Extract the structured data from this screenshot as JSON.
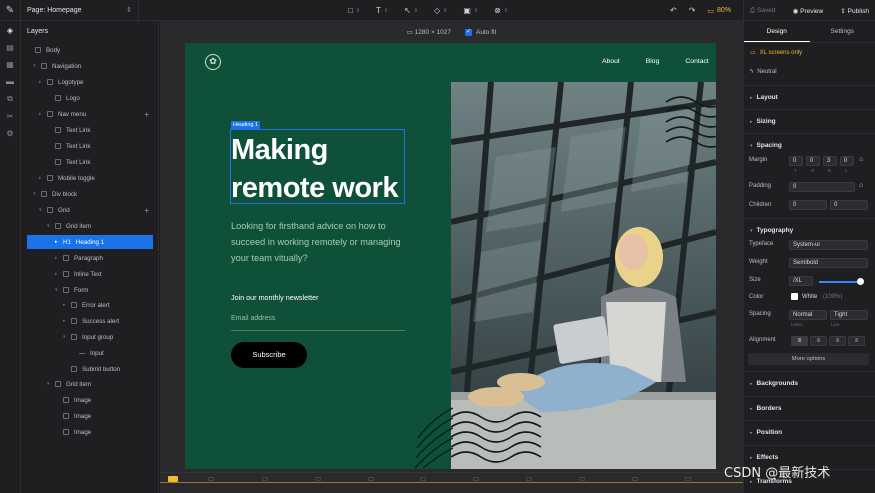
{
  "topbar": {
    "page_label": "Page: Homepage",
    "zoom": "80%",
    "saved": "Saved",
    "preview": "Preview",
    "publish": "Publish"
  },
  "layers": {
    "title": "Layers",
    "items": [
      {
        "label": "Body"
      },
      {
        "label": "Navigation"
      },
      {
        "label": "Logotype"
      },
      {
        "label": "Logo"
      },
      {
        "label": "Nav menu"
      },
      {
        "label": "Text Link"
      },
      {
        "label": "Text Link"
      },
      {
        "label": "Text Link"
      },
      {
        "label": "Mobile toggle"
      },
      {
        "label": "Div block"
      },
      {
        "label": "Grid"
      },
      {
        "label": "Grid item"
      },
      {
        "label": "Heading 1"
      },
      {
        "label": "Paragraph"
      },
      {
        "label": "Inline Text"
      },
      {
        "label": "Form"
      },
      {
        "label": "Error alert"
      },
      {
        "label": "Success alert"
      },
      {
        "label": "Input group"
      },
      {
        "label": "Input"
      },
      {
        "label": "Submit button"
      },
      {
        "label": "Grid item"
      },
      {
        "label": "Image"
      },
      {
        "label": "Image"
      },
      {
        "label": "Image"
      }
    ]
  },
  "canvas": {
    "size": "1280 × 1027",
    "autofit": "Auto fit"
  },
  "site": {
    "nav": [
      "About",
      "Blog",
      "Contact"
    ],
    "heading_tag": "Heading 1",
    "heading_line1": "Making",
    "heading_line2": "remote work",
    "paragraph": "Looking for firsthand advice on how to succeed in working remotely or managing your team vitually?",
    "newsletter": "Join our monthly newsletter",
    "email_placeholder": "Email address",
    "subscribe": "Subscribe"
  },
  "panel": {
    "tabs": [
      "Design",
      "Settings"
    ],
    "xl_only": "XL screens only",
    "neutral": "Neutral",
    "sections": {
      "layout": "Layout",
      "sizing": "Sizing",
      "spacing": "Spacing",
      "typography": "Typography",
      "backgrounds": "Backgrounds",
      "borders": "Borders",
      "position": "Position",
      "effects": "Effects",
      "transforms": "Transforms"
    },
    "margin_label": "Margin",
    "margin": [
      "0",
      "0",
      "3",
      "0"
    ],
    "margin_sub": [
      "T",
      "R",
      "B",
      "L"
    ],
    "padding_label": "Padding",
    "padding": "0",
    "children_label": "Children",
    "children": [
      "0",
      "0"
    ],
    "typeface_label": "Typeface",
    "typeface": "System-ui",
    "weight_label": "Weight",
    "weight": "Semibold",
    "size_label": "Size",
    "size": "/XL",
    "color_label": "Color",
    "color": "White",
    "color_opacity": "(100%)",
    "spacing_label": "Spacing",
    "letter": "Normal",
    "line": "Tight",
    "letter_sub": "Letter",
    "line_sub": "Line",
    "alignment_label": "Alignment",
    "more_options": "More options"
  },
  "watermark": "CSDN @最新技术"
}
